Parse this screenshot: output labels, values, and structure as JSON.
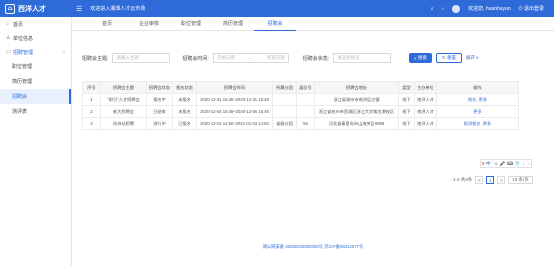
{
  "header": {
    "logo_text": "西洋人才",
    "site_title": "欢迎进入湘潭人才云市场",
    "user_name": "欢迎您, huanhuyun",
    "logout_label": "退出登录"
  },
  "sidebar": {
    "items": [
      {
        "label": "首页",
        "icon": "home-icon"
      },
      {
        "label": "单位信息",
        "icon": "user-icon"
      },
      {
        "label": "招聘管理",
        "icon": "monitor-icon"
      },
      {
        "label": "职位管理"
      },
      {
        "label": "简历管理"
      },
      {
        "label": "招聘会"
      },
      {
        "label": "测评表"
      }
    ]
  },
  "tabs": [
    "首页",
    "企业审核",
    "职位管理",
    "简历管理",
    "招聘会"
  ],
  "filters": {
    "theme_label": "招聘会主题:",
    "theme_placeholder": "请输入主题",
    "time_label": "招聘会时间:",
    "start_placeholder": "开始日期",
    "range_sep": "—",
    "end_placeholder": "结束日期",
    "status_label": "招聘会状态:",
    "status_placeholder": "请选择状态",
    "search_label": "搜索",
    "reset_label": "重置",
    "expand_label": "展开"
  },
  "table": {
    "headers": [
      "序号",
      "招聘会主题",
      "招聘会状态",
      "报名状态",
      "招聘会时间",
      "所属分团",
      "展位号",
      "招聘会地址",
      "类型",
      "主办单位",
      "操作"
    ],
    "rows": [
      [
        "1",
        "\"职引\"人才招聘会",
        "报名中",
        "未报名",
        "2020-12-31 15:48~2020-12-31 15:48",
        "",
        "",
        "浙江省湖州市南浔区古镇",
        "线下",
        "南浔人才",
        "报名, 更多"
      ],
      [
        "2",
        "新大招聘会",
        "已结束",
        "未报名",
        "2020-12-04 15:48~2020-12-05 15:48",
        "",
        "",
        "浙江省杭州市西湖区浙江大学紫金港校区",
        "线下",
        "南浔人才",
        "更多"
      ],
      [
        "3",
        "杭州站招聘",
        "进行中",
        "已报名",
        "2020-12-04 14:50~2021-01-03 14:50",
        "省级分团",
        "55",
        "河北省秦皇岛市山海关区9999",
        "线下",
        "南浔人才",
        "取消报名, 更多"
      ]
    ]
  },
  "pagination": {
    "total": "1-3 共3条",
    "prev": "<",
    "page": "1",
    "next": ">",
    "page_size": "10 条/页"
  },
  "float_toolbar": [
    "S",
    "中",
    "ʼ",
    "☺",
    "🎤",
    "⌨",
    "👕",
    "⋮⋮"
  ],
  "footer": "湖公网安备 33050202000300号 苏ICP备05012677号"
}
